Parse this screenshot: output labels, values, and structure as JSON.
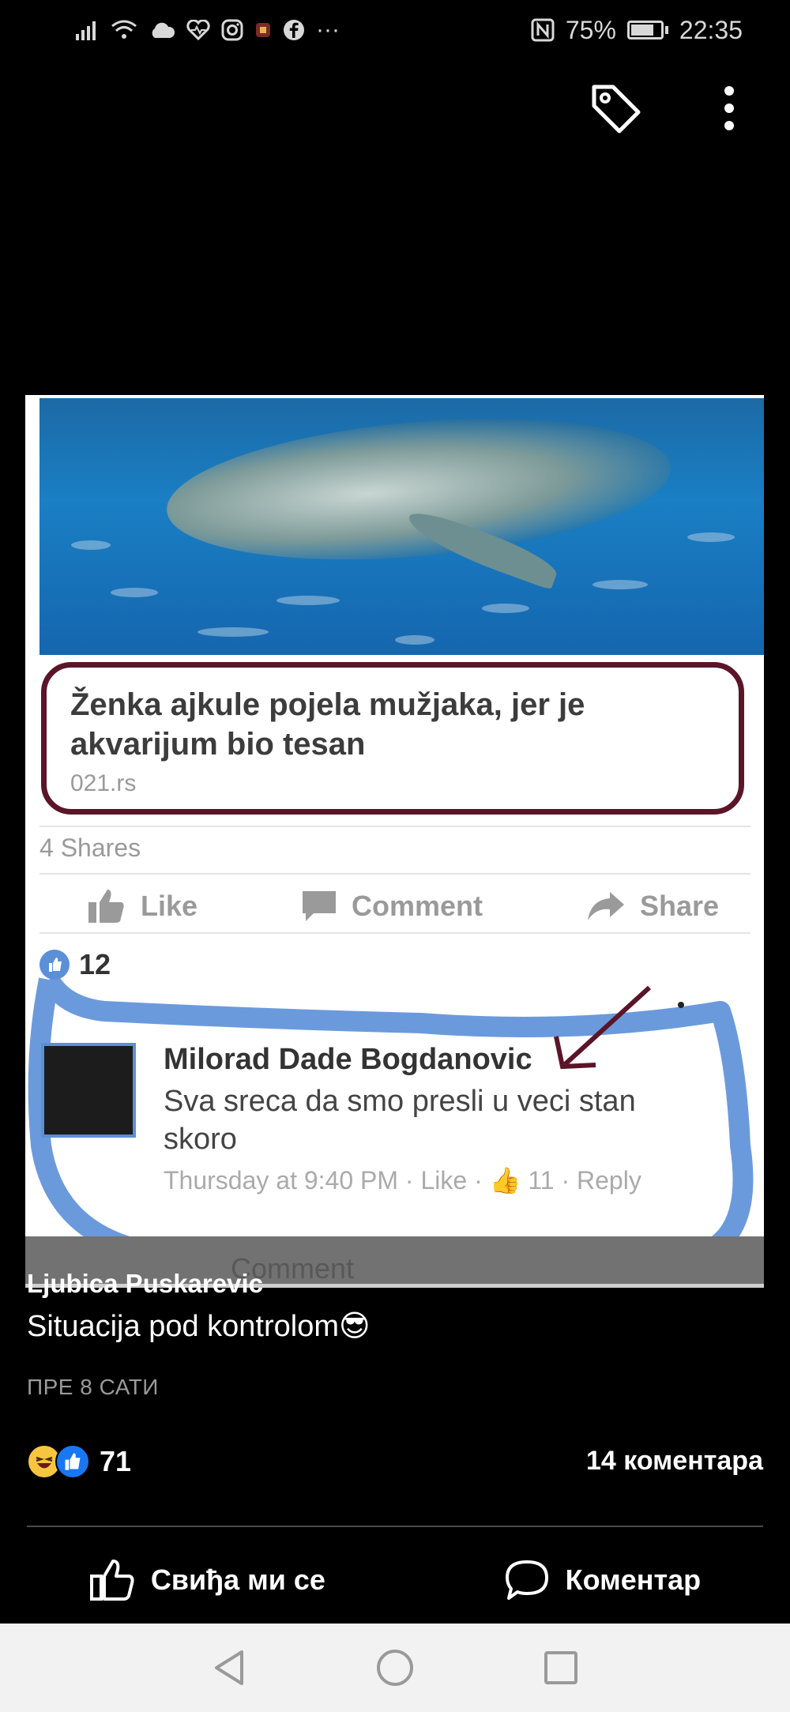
{
  "status_bar": {
    "battery": "75%",
    "time": "22:35",
    "left_icons": [
      "signal-icon",
      "wifi-icon",
      "cloud-icon",
      "health-icon",
      "instagram-icon",
      "app-icon",
      "facebook-icon",
      "more-icon"
    ],
    "more_dots": "···"
  },
  "toolbar": {
    "tag_icon": "tag-icon",
    "menu_icon": "more-vert-icon"
  },
  "shared_image": {
    "headline": "Ženka ajkule pojela mužjaka, jer je akvarijum bio tesan",
    "domain": "021.rs",
    "shares": "4 Shares",
    "actions": {
      "like": "Like",
      "comment": "Comment",
      "share": "Share"
    },
    "likes_count": "12",
    "comment": {
      "author": "Milorad Dade Bogdanovic",
      "text": "Sva sreca da smo presli u veci stan skoro",
      "meta": "Thursday at 9:40 PM · Like · 👍 11 · Reply"
    },
    "footer_ghost": "Comment"
  },
  "post": {
    "author": "Ljubica Puskarevic",
    "caption": "Situacija pod kontrolom😎",
    "time_ago": "ПРЕ 8 САТИ",
    "reactions_count": "71",
    "comments_count": "14 коментара",
    "like_label": "Свиђа ми се",
    "comment_label": "Коментар"
  },
  "colors": {
    "background": "#000000",
    "accent_blue": "#1877f2",
    "scribble_blue": "#5b8fd8",
    "headline_border": "#5b1528"
  }
}
